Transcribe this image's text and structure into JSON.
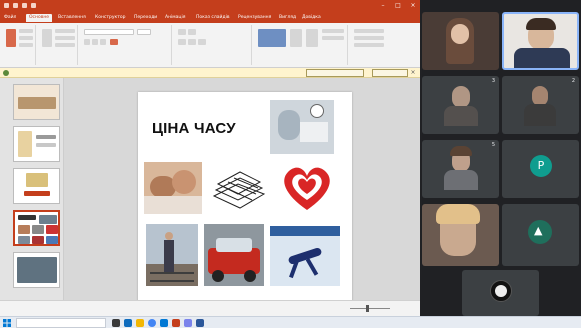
{
  "powerpoint": {
    "ribbon_tabs": [
      "Файл",
      "Основне",
      "Вставлення",
      "Конструктор",
      "Переходи",
      "Анімація",
      "Показ слайдів",
      "Рецензування",
      "Вигляд",
      "Довідка"
    ],
    "slide": {
      "title": "ЦІНА ЧАСУ"
    }
  },
  "meet": {
    "tiles": [
      {
        "badge": "3"
      },
      {
        "badge": "2"
      },
      {
        "badge": "5"
      },
      {
        "avatar_letter": "P"
      }
    ]
  },
  "colors": {
    "powerpoint_accent": "#c43e1c",
    "meet_background": "#202124",
    "meet_avatar": "#0f9d8f"
  }
}
